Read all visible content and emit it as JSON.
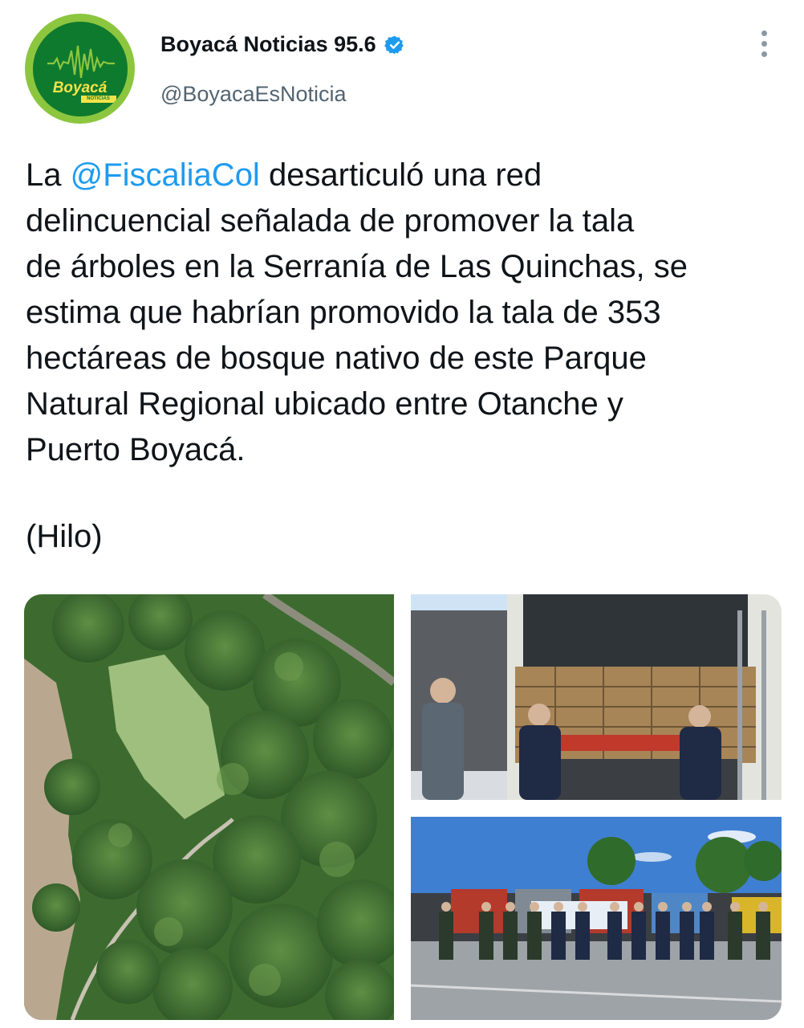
{
  "account": {
    "display_name": "Boyacá Noticias 95.6",
    "handle": "@BoyacaEsNoticia",
    "avatar_logo_text": "Boyacá",
    "avatar_logo_subtext": "NOTICIAS",
    "verified": true
  },
  "tweet": {
    "text_before": "La ",
    "mention": "@FiscaliaCol",
    "text_after": " desarticuló una red\ndelincuencial señalada de promover la tala\nde árboles en la Serranía de Las Quinchas, se\nestima que habrían promovido la tala de 353\nhectáreas de bosque nativo de este Parque\nNatural Regional ubicado entre Otanche y\nPuerto Boyacá.",
    "thread_label": "(Hilo)"
  },
  "media": {
    "photos": [
      {
        "subject": "aerial-forest-photo"
      },
      {
        "subject": "timber-truck-officers-photo"
      },
      {
        "subject": "trucks-group-photo"
      }
    ]
  },
  "colors": {
    "accent": "#1d9bf0",
    "text": "#0f1419",
    "secondary_text": "#536471",
    "logo_ring": "#8cc63f",
    "logo_fill": "#0e7a2e"
  }
}
